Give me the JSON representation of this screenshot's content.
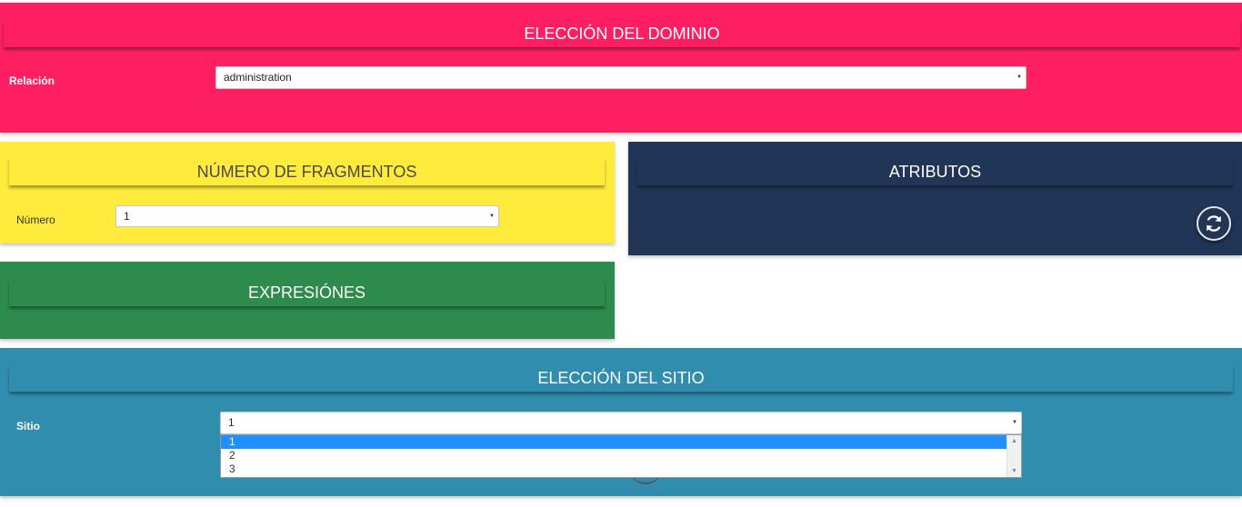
{
  "dominio": {
    "title": "ELECCIÓN DEL DOMINIO",
    "field_label": "Relación",
    "selected": "administration"
  },
  "fragmentos": {
    "title": "NÚMERO DE FRAGMENTOS",
    "field_label": "Número",
    "selected": "1"
  },
  "atributos": {
    "title": "ATRIBUTOS",
    "refresh_icon": "refresh-icon"
  },
  "expresiones": {
    "title": "EXPRESIÓNES"
  },
  "sitio": {
    "title": "ELECCIÓN DEL SITIO",
    "field_label": "Sitio",
    "selected": "1",
    "options": [
      "1",
      "2",
      "3"
    ]
  },
  "colors": {
    "dominio": "#fe1f63",
    "fragmentos": "#ffeb3b",
    "atributos": "#213557",
    "expresiones": "#2e8b4e",
    "sitio": "#318dad",
    "option_highlight": "#1e90ff"
  }
}
